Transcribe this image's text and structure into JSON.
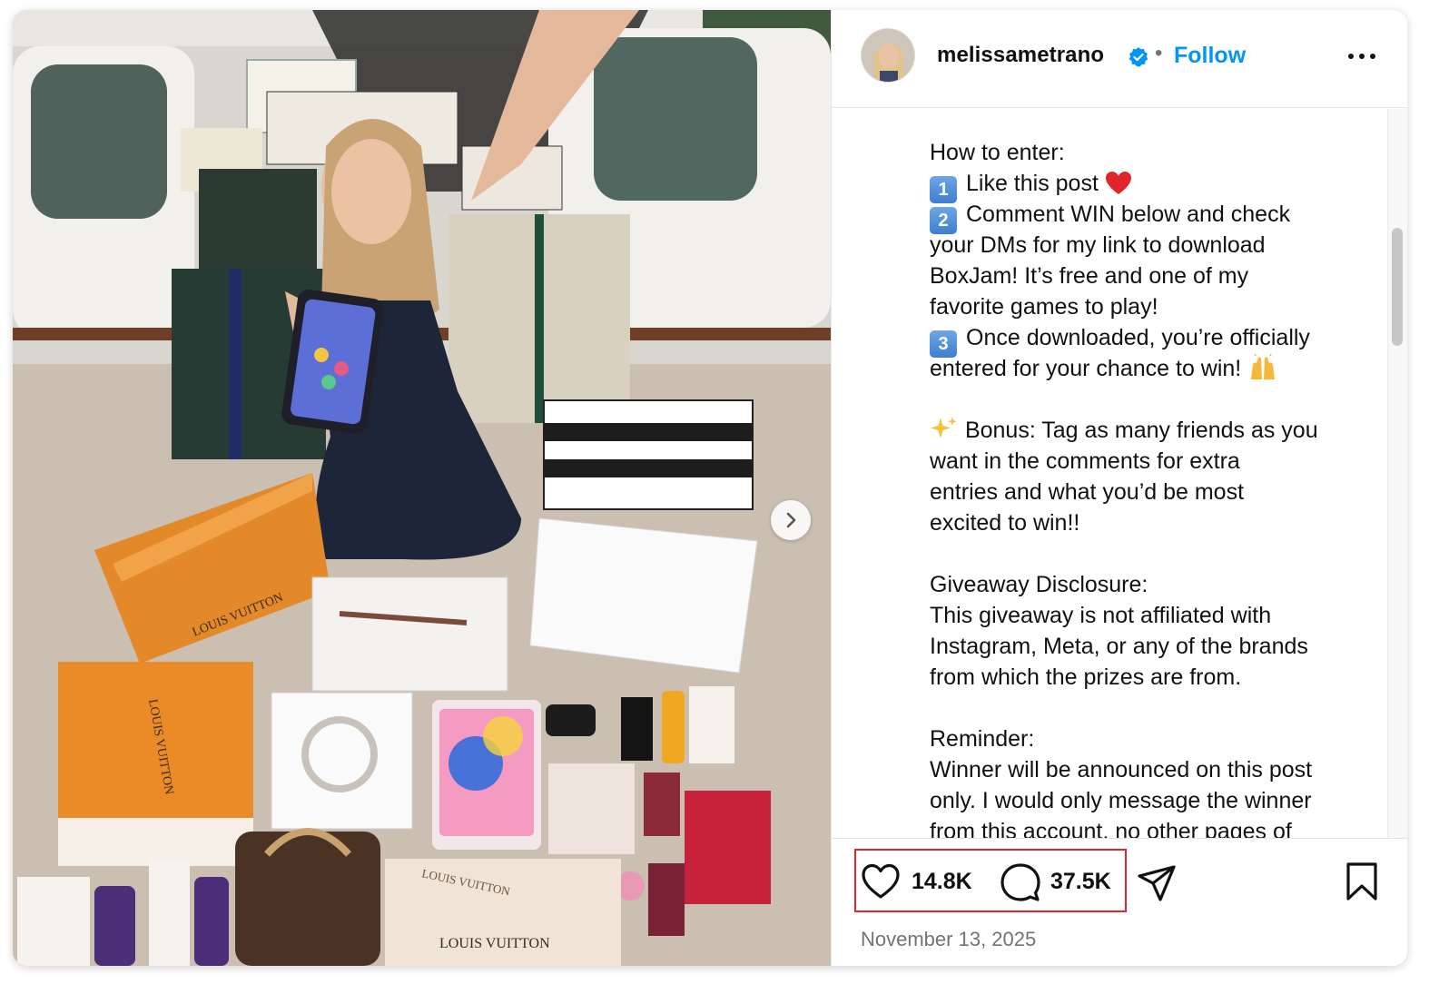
{
  "post": {
    "image_alt": "Woman holding a phone surrounded by giveaway prizes",
    "next_icon": "chevron-right-icon",
    "bag_text_1": "LOUIS VUITTON",
    "bag_text_2": "LOUIS VUITTON",
    "bag_text_3": "LOUIS VUITTON",
    "bag_text_4": "LOUIS VUITTON"
  },
  "header": {
    "username": "melissametrano",
    "verified_icon": "verified-badge-icon",
    "separator": "•",
    "follow_label": "Follow",
    "more_icon": "more-horizontal-icon"
  },
  "caption": {
    "line_1": "How to enter:",
    "step_1_num": "1",
    "step_1_text": "Like this post",
    "step_1_emoji": "red-heart-icon",
    "step_2_num": "2",
    "step_2_text": "Comment WIN below and check",
    "line_4": "your DMs for my link to download",
    "line_5": "BoxJam! It’s free and one of my",
    "line_6": "favorite games to play!",
    "step_3_num": "3",
    "step_3_text": "Once downloaded, you’re officially",
    "line_8": "entered for your chance to win!",
    "line_8_emoji": "raised-hands-icon",
    "bonus_emoji": "sparkles-icon",
    "line_10": "Bonus: Tag as many friends as you",
    "line_11": "want in the comments for extra",
    "line_12": "entries and what you’d be most",
    "line_13": "excited to win!!",
    "line_15": "Giveaway Disclosure:",
    "line_16": "This giveaway is not affiliated with",
    "line_17": "Instagram, Meta, or any of the brands",
    "line_18": "from which the prizes are from.",
    "line_20": "Reminder:",
    "line_21": "Winner will be announced on this post",
    "line_22": "only. I would only message the winner",
    "line_23": "from this account, no other pages of"
  },
  "actions": {
    "like_icon": "heart-icon",
    "like_count": "14.8K",
    "comment_icon": "comment-bubble-icon",
    "comment_count": "37.5K",
    "share_icon": "paper-plane-icon",
    "save_icon": "bookmark-icon",
    "date": "November 13, 2025"
  },
  "colors": {
    "accent": "#0095f6",
    "highlight": "#e0262b",
    "text": "#111111",
    "muted": "#737373"
  }
}
